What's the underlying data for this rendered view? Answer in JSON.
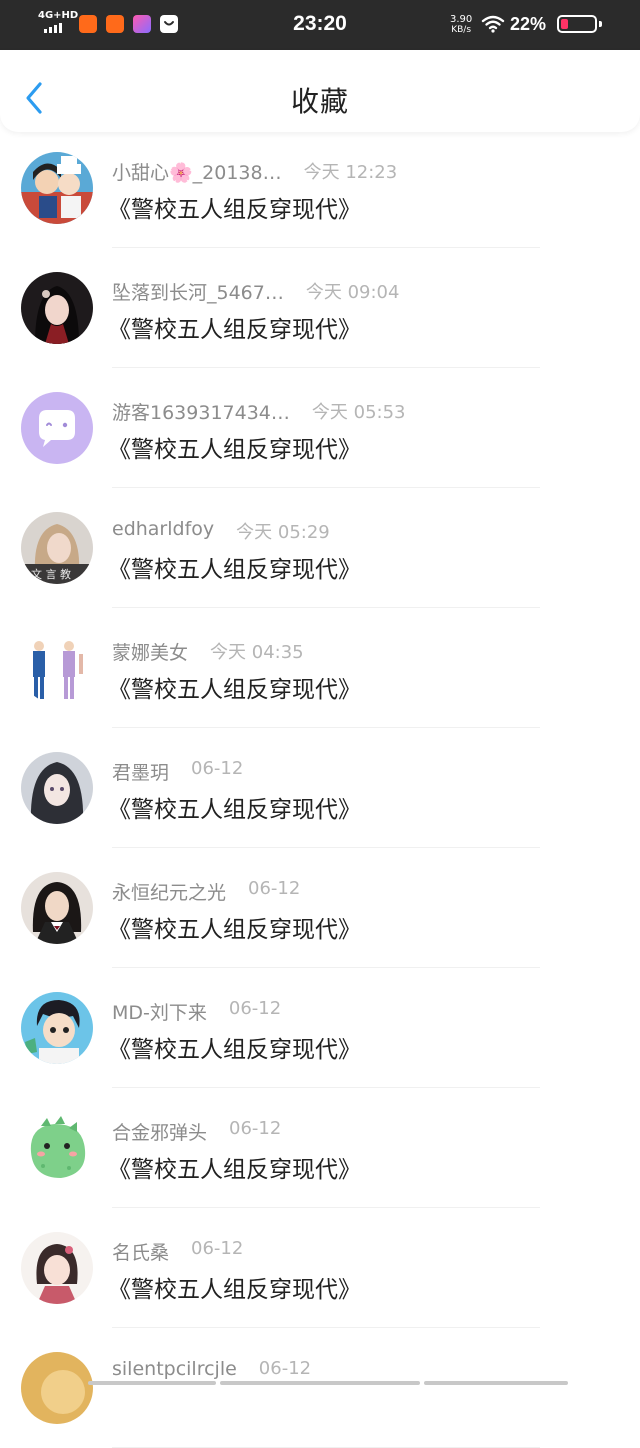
{
  "status_bar": {
    "network": "4G+HD",
    "time": "23:20",
    "net_speed_value": "3.90",
    "net_speed_unit": "KB/s",
    "battery": "22%",
    "battery_level": 0.22,
    "battery_color": "#ff3366"
  },
  "header": {
    "back_icon": "chevron-left-icon",
    "title": "收藏",
    "accent_color": "#2c9cf0"
  },
  "list": {
    "items": [
      {
        "name": "小甜心🌸_20138…",
        "time": "今天 12:23",
        "title": "《警校五人组反穿现代》"
      },
      {
        "name": "坠落到长河_5467…",
        "time": "今天 09:04",
        "title": "《警校五人组反穿现代》"
      },
      {
        "name": "游客1639317434…",
        "time": "今天 05:53",
        "title": "《警校五人组反穿现代》"
      },
      {
        "name": "edharldfoy",
        "time": "今天 05:29",
        "title": "《警校五人组反穿现代》"
      },
      {
        "name": "蒙娜美女",
        "time": "今天 04:35",
        "title": "《警校五人组反穿现代》"
      },
      {
        "name": "君墨玥",
        "time": "06-12",
        "title": "《警校五人组反穿现代》"
      },
      {
        "name": "永恒纪元之光",
        "time": "06-12",
        "title": "《警校五人组反穿现代》"
      },
      {
        "name": "MD-刘下来",
        "time": "06-12",
        "title": "《警校五人组反穿现代》"
      },
      {
        "name": "合金邪弹头",
        "time": "06-12",
        "title": "《警校五人组反穿现代》"
      },
      {
        "name": "名氏桑",
        "time": "06-12",
        "title": "《警校五人组反穿现代》"
      },
      {
        "name": "silentpcilrcjle",
        "time": "06-12",
        "title": ""
      }
    ]
  }
}
